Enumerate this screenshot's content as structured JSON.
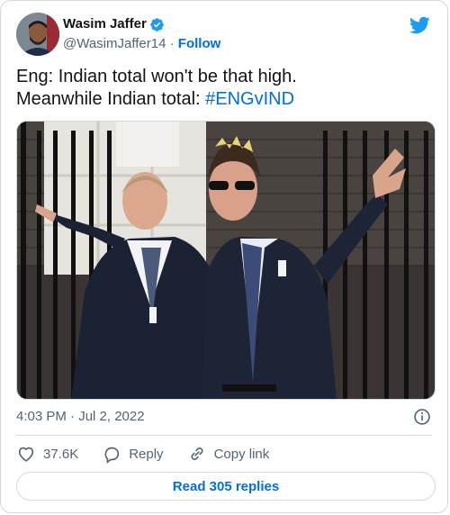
{
  "author": {
    "display_name": "Wasim Jaffer",
    "handle": "@WasimJaffer14",
    "separator": "·",
    "follow_label": "Follow"
  },
  "tweet": {
    "text_line1": "Eng: Indian total won't be that high.",
    "text_line2_prefix": "Meanwhile Indian total: ",
    "hashtag": "#ENGvIND",
    "timestamp": "4:03 PM · Jul 2, 2022"
  },
  "actions": {
    "likes_count": "37.6K",
    "reply_label": "Reply",
    "copy_link_label": "Copy link"
  },
  "read_replies_label": "Read 305 replies",
  "icons": {
    "verified": "verified-badge-icon",
    "brand": "twitter-bird-icon",
    "info": "info-icon",
    "like": "heart-icon",
    "reply": "reply-bubble-icon",
    "link": "link-icon"
  },
  "colors": {
    "accent": "#1d9bf0",
    "link": "#006fd6",
    "secondary_text": "#536471",
    "border": "#cfd9de",
    "blazer_navy": "#1b2233"
  }
}
